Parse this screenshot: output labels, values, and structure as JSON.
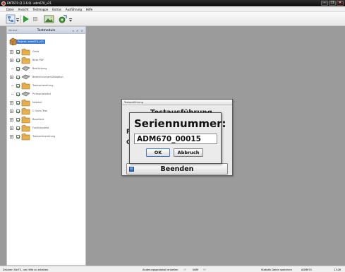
{
  "window": {
    "title": "EMT670 (2.1.6.0): adm670_v21",
    "buttons": {
      "minimize": "–",
      "maximize": "❐",
      "close": "✕"
    }
  },
  "menu": [
    "Datei",
    "Ansicht",
    "Testmappe",
    "Extras",
    "Ausführung",
    "Hilfe"
  ],
  "toolbar": {
    "icons": [
      "hierarchy-icon",
      "dropdown-arrow-icon",
      "play-icon",
      "stop-icon",
      "image-icon",
      "settings-icon",
      "dropdown-arrow-icon"
    ]
  },
  "panel": {
    "pinned_label": "Verlauf",
    "title": "Testmodule",
    "controls": "▾ ✕ ✕",
    "project": "Projekt: adm670_v21",
    "items": [
      {
        "label": "Gehä",
        "expandable": true
      },
      {
        "label": "Bitte PDF",
        "expandable": true
      },
      {
        "label": "Bestückung",
        "expandable": false
      },
      {
        "label": "Bezeichnungen/Adaption",
        "expandable": true
      },
      {
        "label": "Testvorbereitung",
        "expandable": false
      },
      {
        "label": "Prüfvorbeleitet",
        "expandable": false
      },
      {
        "label": "Netzteil",
        "expandable": true
      },
      {
        "label": "C Open Test",
        "expandable": true
      },
      {
        "label": "Baseltest",
        "expandable": true
      },
      {
        "label": "Funktionstest",
        "expandable": true
      },
      {
        "label": "Testnachbereitung",
        "expandable": true
      }
    ]
  },
  "test_dialog": {
    "title": "Testausführung",
    "heading": "Testausführung",
    "side_labels": [
      "F",
      "G"
    ],
    "end_button": "Beenden"
  },
  "serial_dialog": {
    "title": "Seriennummer:",
    "value": "ADM670_00015",
    "ok": "OK",
    "cancel": "Abbruch"
  },
  "status": {
    "help": "Drücken Sie F1, um Hilfe zu erhalten.",
    "protocol": "Änderungsprotokoll erstellen",
    "caps": "UF",
    "num": "NUM",
    "scroll": "RF",
    "stats": "Statistik Daten speichern",
    "device": "ADM670",
    "time": "13:28"
  },
  "colors": {
    "selection": "#3a78d4",
    "play": "#2ea02e",
    "workspace": "#9b9b9b"
  }
}
